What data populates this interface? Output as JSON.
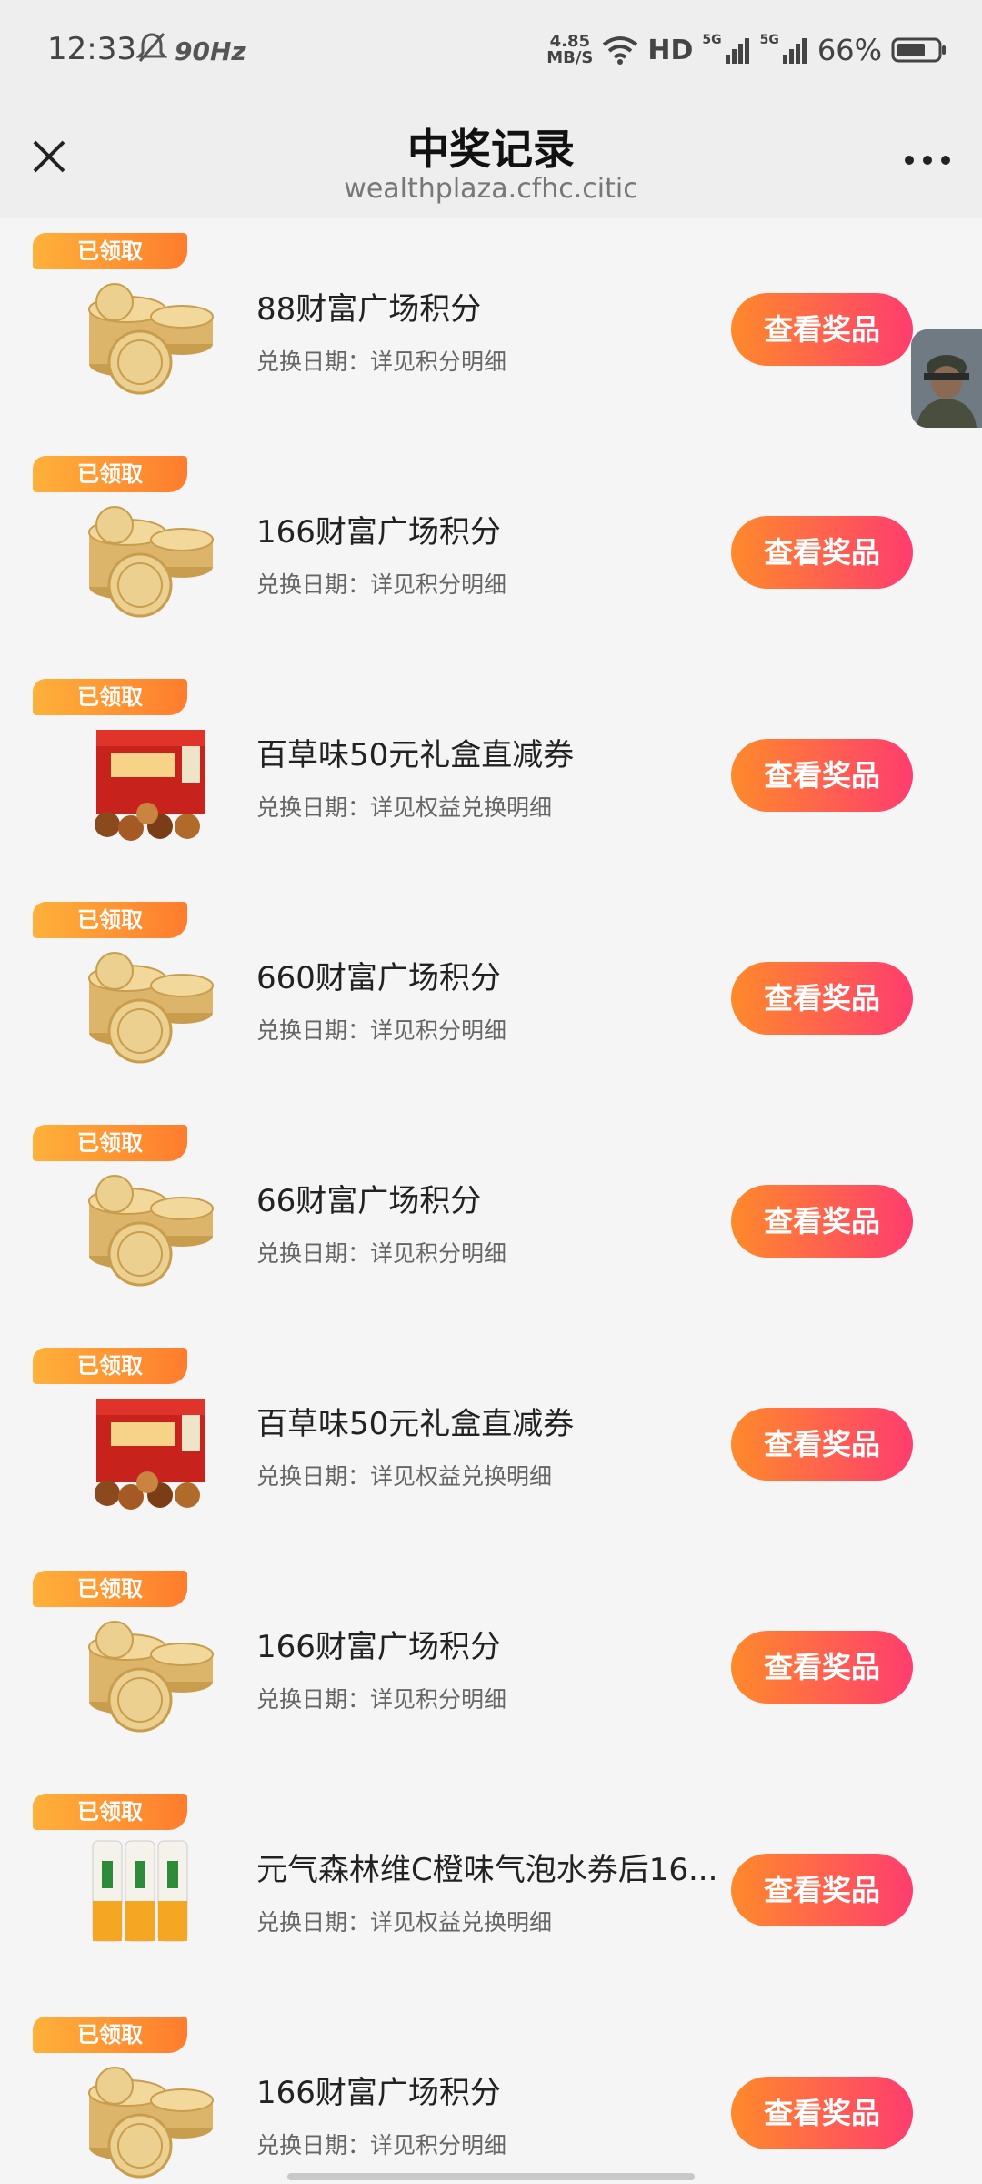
{
  "status": {
    "time": "12:33",
    "refresh": "90Hz",
    "speed_top": "4.85",
    "speed_unit": "MB/S",
    "hd": "HD",
    "net1": "5G",
    "net2": "5G",
    "battery": "66%"
  },
  "nav": {
    "title": "中奖记录",
    "subtitle": "wealthplaza.cfhc.citic"
  },
  "items": [
    {
      "badge": "已领取",
      "title": "88财富广场积分",
      "date": "兑换日期：详见积分明细",
      "button": "查看奖品",
      "thumb": "coins-icon"
    },
    {
      "badge": "已领取",
      "title": "166财富广场积分",
      "date": "兑换日期：详见积分明细",
      "button": "查看奖品",
      "thumb": "coins-icon"
    },
    {
      "badge": "已领取",
      "title": "百草味50元礼盒直减券",
      "date": "兑换日期：详见权益兑换明细",
      "button": "查看奖品",
      "thumb": "gift-box-icon"
    },
    {
      "badge": "已领取",
      "title": "660财富广场积分",
      "date": "兑换日期：详见积分明细",
      "button": "查看奖品",
      "thumb": "coins-icon"
    },
    {
      "badge": "已领取",
      "title": "66财富广场积分",
      "date": "兑换日期：详见积分明细",
      "button": "查看奖品",
      "thumb": "coins-icon"
    },
    {
      "badge": "已领取",
      "title": "百草味50元礼盒直减券",
      "date": "兑换日期：详见权益兑换明细",
      "button": "查看奖品",
      "thumb": "gift-box-icon"
    },
    {
      "badge": "已领取",
      "title": "166财富广场积分",
      "date": "兑换日期：详见积分明细",
      "button": "查看奖品",
      "thumb": "coins-icon"
    },
    {
      "badge": "已领取",
      "title": "元气森林维C橙味气泡水券后16...",
      "date": "兑换日期：详见权益兑换明细",
      "button": "查看奖品",
      "thumb": "drink-cans-icon"
    },
    {
      "badge": "已领取",
      "title": "166财富广场积分",
      "date": "兑换日期：详见积分明细",
      "button": "查看奖品",
      "thumb": "coins-icon"
    }
  ],
  "colors": {
    "badge": "#ff9a33",
    "button_start": "#ff8a2b",
    "button_end": "#ff3d6e"
  }
}
